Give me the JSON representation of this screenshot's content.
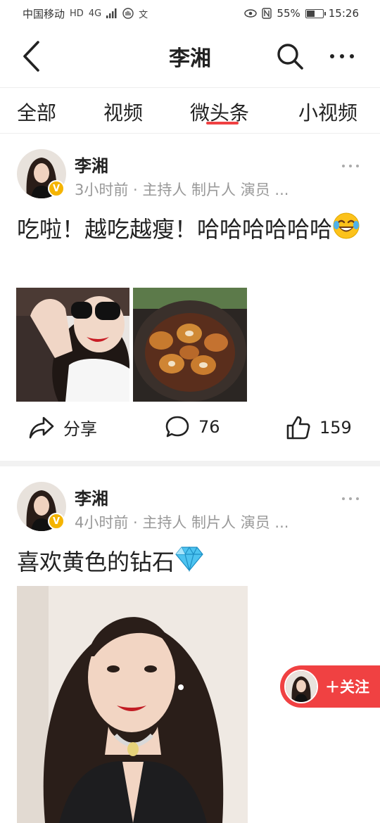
{
  "status_bar": {
    "carrier": "中国移动",
    "network": "4G",
    "battery": "55%",
    "battery_level": 0.55,
    "time": "15:26"
  },
  "nav": {
    "title": "李湘"
  },
  "tabs": [
    "全部",
    "视频",
    "微头条",
    "小视频"
  ],
  "active_tab": "微头条",
  "posts": [
    {
      "author": "李湘",
      "meta": "3小时前 · 主持人 制片人 演员 ...",
      "text": "吃啦！越吃越瘦！哈哈哈哈哈哈",
      "emoji": "laughing-tears-emoji",
      "share_label": "分享",
      "comments": "76",
      "likes": "159"
    },
    {
      "author": "李湘",
      "meta": "4小时前 · 主持人 制片人 演员 ...",
      "text": "喜欢黄色的钻石",
      "emoji": "diamond-emoji"
    }
  ],
  "follow_button": {
    "label": "＋关注"
  },
  "colors": {
    "accent": "#f04142",
    "verified": "#f5b400",
    "meta_text": "#999999"
  }
}
